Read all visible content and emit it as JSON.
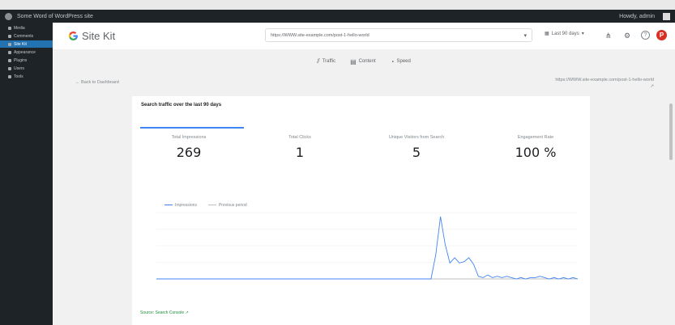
{
  "admin_bar": {
    "site_name": "Some Word of WordPress site",
    "howdy": "Howdy, admin"
  },
  "sidebar": {
    "items": [
      {
        "label": "Media"
      },
      {
        "label": "Comments"
      },
      {
        "label": "Site Kit"
      },
      {
        "label": "Appearance"
      },
      {
        "label": "Plugins"
      },
      {
        "label": "Users"
      },
      {
        "label": "Tools"
      }
    ]
  },
  "header": {
    "brand": "Site Kit",
    "url_select": "https://WWW.site-example.com/post-1-hello-world",
    "date_range": "Last 90 days",
    "help": "?",
    "avatar_initial": "P"
  },
  "nav": {
    "tabs": [
      {
        "label": "Traffic",
        "icon": "traffic-icon"
      },
      {
        "label": "Content",
        "icon": "content-icon"
      },
      {
        "label": "Speed",
        "icon": "speed-icon"
      }
    ]
  },
  "subheader": {
    "back_link": "←  Back to Dashboard",
    "page_url": "https://WWW.site-example.com/post-1-hello-world",
    "page_url_suffix": "↗"
  },
  "card": {
    "title": "Search traffic over the last 90 days",
    "metrics": [
      {
        "label": "Total Impressions",
        "value": "269"
      },
      {
        "label": "Total Clicks",
        "value": "1"
      },
      {
        "label": "Unique Visitors from Search",
        "value": "5"
      },
      {
        "label": "Engagement Rate",
        "value": "100 %"
      }
    ],
    "legend": [
      "Impressions",
      "Previous period"
    ],
    "footer": "Source: Search Console ↗"
  },
  "colors": {
    "accent": "#4285f4",
    "admin_bg": "#1d2327",
    "line_primary": "#4285f4",
    "line_previous": "#bdc1c6"
  },
  "chart_data": {
    "type": "line",
    "series": [
      {
        "name": "Impressions",
        "values": [
          0,
          0,
          0,
          0,
          0,
          0,
          0,
          0,
          0,
          0,
          0,
          0,
          0,
          0,
          0,
          0,
          0,
          0,
          0,
          0,
          0,
          0,
          0,
          0,
          0,
          0,
          0,
          0,
          0,
          0,
          0,
          0,
          0,
          0,
          0,
          0,
          0,
          0,
          0,
          0,
          0,
          0,
          0,
          0,
          0,
          0,
          0,
          0,
          0,
          0,
          0,
          0,
          0,
          0,
          0,
          0,
          0,
          0,
          0,
          18,
          47,
          26,
          12,
          16,
          12,
          13,
          16,
          11,
          2,
          1,
          3,
          1,
          2,
          1,
          2,
          1,
          0,
          1,
          0,
          1,
          1,
          2,
          1,
          0,
          1,
          0,
          1,
          0,
          1,
          0
        ]
      },
      {
        "name": "Previous period",
        "values": [
          0,
          0,
          0,
          0,
          0,
          0,
          0,
          0,
          0,
          0,
          0,
          0,
          0,
          0,
          0,
          0,
          0,
          0,
          0,
          0,
          0,
          0,
          0,
          0,
          0,
          0,
          0,
          0,
          0,
          0,
          0,
          0,
          0,
          0,
          0,
          0,
          0,
          0,
          0,
          0,
          0,
          0,
          0,
          0,
          0,
          0,
          0,
          0,
          0,
          0,
          0,
          0,
          0,
          0,
          0,
          0,
          0,
          0,
          0,
          0,
          0,
          0,
          0,
          0,
          0,
          0,
          0,
          0,
          0,
          0,
          0,
          0,
          0,
          0,
          0,
          0,
          0,
          0,
          0,
          0,
          0,
          0,
          0,
          0,
          0,
          0,
          0,
          0,
          0,
          0
        ]
      }
    ],
    "ylim": [
      0,
      50
    ],
    "grid": true,
    "legend_position": "top-left"
  }
}
